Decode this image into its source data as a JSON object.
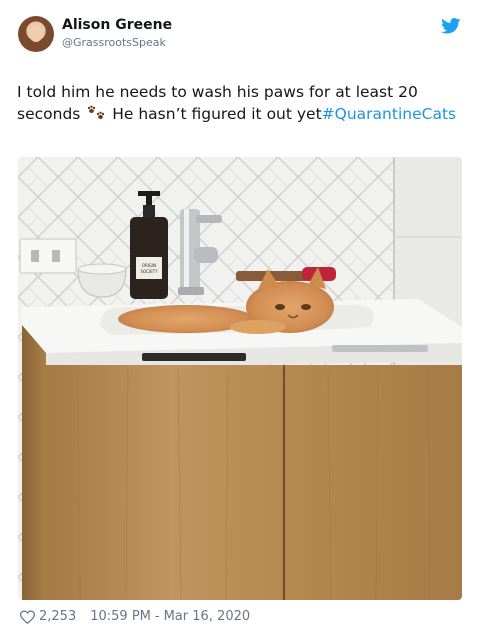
{
  "author": {
    "display_name": "Alison Greene",
    "handle": "@GrassrootsSpeak"
  },
  "tweet": {
    "text_before": "I told him he needs to wash his paws for at least 20 seconds",
    "paws_icon": "paw-prints-icon",
    "text_after": " He hasn’t figured it out yet",
    "hashtag": "#QuarantineCats"
  },
  "photo": {
    "soap_label": "ORIGIN\nSOCIETY"
  },
  "footer": {
    "likes": "2,253",
    "time": "10:59 PM",
    "separator": "-",
    "date": "Mar 16, 2020"
  },
  "colors": {
    "brand": "#1da1f2",
    "hashtag": "#1b95e0",
    "muted": "#657786"
  },
  "icons": {
    "brand": "twitter-bird-icon",
    "like": "heart-icon"
  }
}
